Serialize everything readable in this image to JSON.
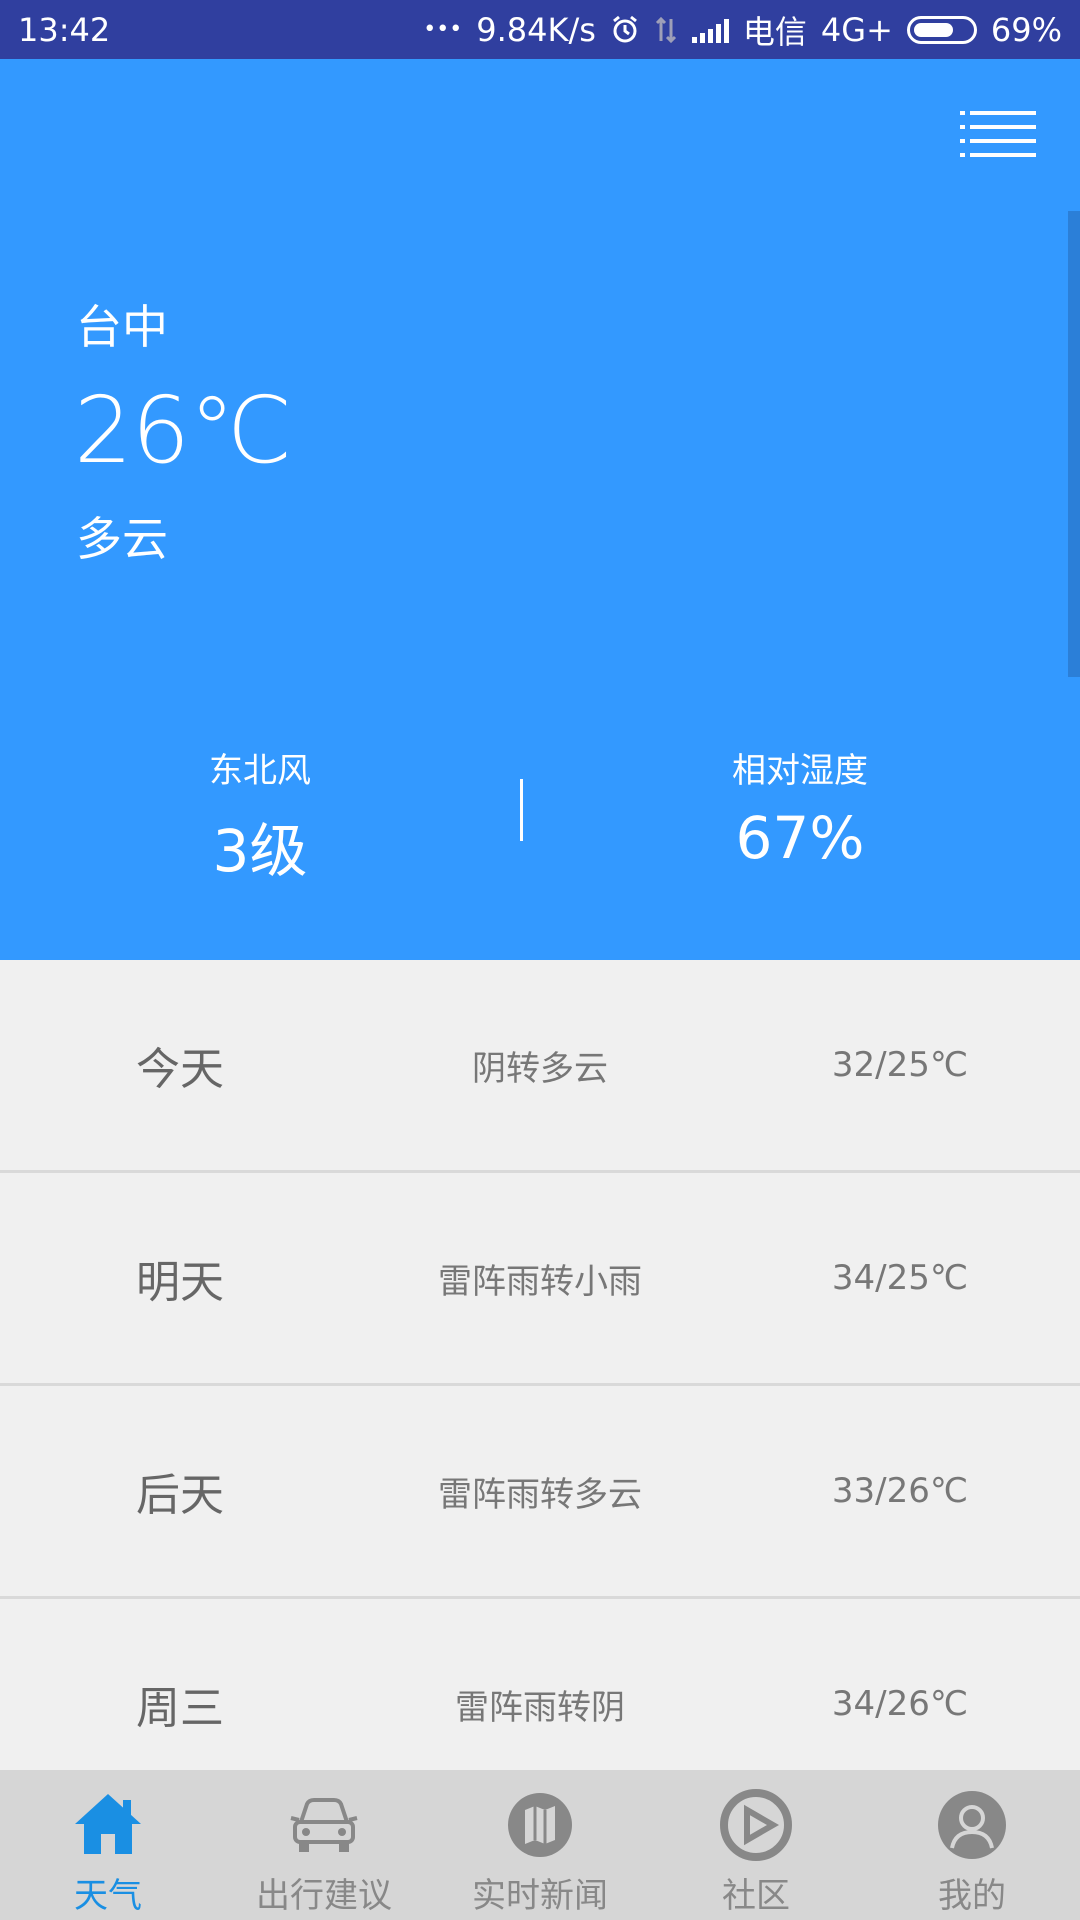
{
  "status_bar": {
    "time": "13:42",
    "dots": "•••",
    "speed": "9.84K/s",
    "carrier": "电信",
    "network": "4G+",
    "battery": "69%",
    "battery_level": 0.69
  },
  "weather": {
    "city": "台中",
    "temperature": "26℃",
    "condition": "多云",
    "wind_label": "东北风",
    "wind_value": "3级",
    "humidity_label": "相对湿度",
    "humidity_value": "67%"
  },
  "forecast": [
    {
      "day": "今天",
      "desc": "阴转多云",
      "range": "32/25℃"
    },
    {
      "day": "明天",
      "desc": "雷阵雨转小雨",
      "range": "34/25℃"
    },
    {
      "day": "后天",
      "desc": "雷阵雨转多云",
      "range": "33/26℃"
    },
    {
      "day": "周三",
      "desc": "雷阵雨转阴",
      "range": "34/26℃"
    }
  ],
  "nav": {
    "items": [
      {
        "label": "天气",
        "icon": "home-icon"
      },
      {
        "label": "出行建议",
        "icon": "car-icon"
      },
      {
        "label": "实时新闻",
        "icon": "map-icon"
      },
      {
        "label": "社区",
        "icon": "play-icon"
      },
      {
        "label": "我的",
        "icon": "user-icon"
      }
    ]
  },
  "colors": {
    "header": "#3399ff",
    "status_bar": "#303f9f",
    "active": "#1a8fe3",
    "inactive": "#888888"
  }
}
